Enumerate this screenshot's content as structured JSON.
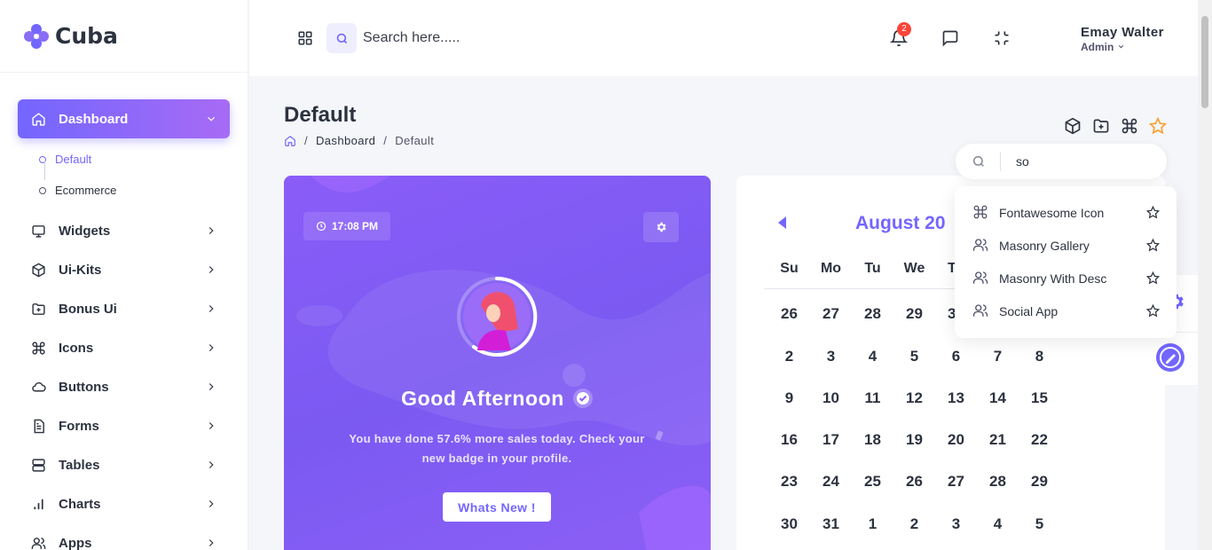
{
  "brand": {
    "name": "Cuba",
    "color": "#7366ff"
  },
  "sidebar": {
    "items": [
      {
        "label": "Dashboard",
        "icon": "home-icon",
        "active": true
      },
      {
        "label": "Widgets",
        "icon": "monitor-icon"
      },
      {
        "label": "Ui-Kits",
        "icon": "cube-icon"
      },
      {
        "label": "Bonus Ui",
        "icon": "folder-plus-icon"
      },
      {
        "label": "Icons",
        "icon": "command-icon"
      },
      {
        "label": "Buttons",
        "icon": "cloud-icon"
      },
      {
        "label": "Forms",
        "icon": "file-text-icon"
      },
      {
        "label": "Tables",
        "icon": "server-icon"
      },
      {
        "label": "Charts",
        "icon": "bar-chart-icon"
      },
      {
        "label": "Apps",
        "icon": "users-icon"
      }
    ],
    "dashboard_sub": [
      {
        "label": "Default",
        "active": true
      },
      {
        "label": "Ecommerce"
      }
    ]
  },
  "header": {
    "search_placeholder": "Search here.....",
    "notification_count": "2",
    "user_name": "Emay Walter",
    "user_role": "Admin"
  },
  "page": {
    "title": "Default",
    "breadcrumb": [
      "Dashboard",
      "Default"
    ]
  },
  "welcome": {
    "time": "17:08 PM",
    "greeting": "Good Afternoon",
    "message": "You have done 57.6% more sales today. Check your new badge in your profile.",
    "button": "Whats New !"
  },
  "calendar": {
    "month": "August 20",
    "weekdays": [
      "Su",
      "Mo",
      "Tu",
      "We",
      "T"
    ],
    "weeks": [
      [
        "26",
        "27",
        "28",
        "29",
        "3"
      ],
      [
        "2",
        "3",
        "4",
        "5",
        "6",
        "7",
        "8"
      ],
      [
        "9",
        "10",
        "11",
        "12",
        "13",
        "14",
        "15"
      ],
      [
        "16",
        "17",
        "18",
        "19",
        "20",
        "21",
        "22"
      ],
      [
        "23",
        "24",
        "25",
        "26",
        "27",
        "28",
        "29"
      ],
      [
        "30",
        "31",
        "1",
        "2",
        "3",
        "4",
        "5"
      ]
    ]
  },
  "bookmark_search": {
    "query": "so",
    "results": [
      {
        "label": "Fontawesome Icon",
        "icon": "command-icon"
      },
      {
        "label": "Masonry Gallery",
        "icon": "users-icon"
      },
      {
        "label": "Masonry With Desc",
        "icon": "users-icon"
      },
      {
        "label": "Social App",
        "icon": "users-icon"
      }
    ]
  }
}
